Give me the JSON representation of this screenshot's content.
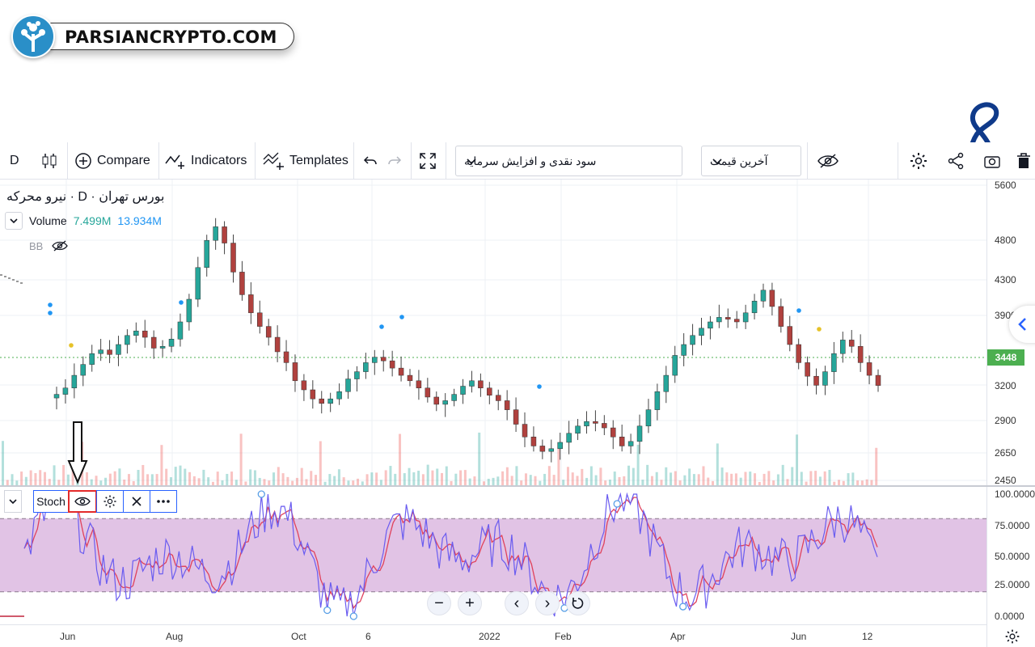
{
  "logo": {
    "text": "PARSIANCRYPTO.COM"
  },
  "toolbar": {
    "interval": "D",
    "compare_label": "Compare",
    "indicators_label": "Indicators",
    "templates_label": "Templates",
    "symbol_dropdown": "سود نقدی و افزایش سرمایه",
    "price_dropdown": "آخرین قیمت"
  },
  "legend": {
    "title": "بورس تهران · D · نیرو محرکه",
    "volume_label": "Volume",
    "volume_v1": "7.499M",
    "volume_v2": "13.934M",
    "bb_label": "BB",
    "stoch_label": "Stoch"
  },
  "price_axis": [
    "5600",
    "4800",
    "4300",
    "3900",
    "3448",
    "3200",
    "2900",
    "2650",
    "2450"
  ],
  "current_price": "3448",
  "stoch_axis": [
    "100.0000",
    "75.0000",
    "50.0000",
    "25.0000",
    "0.0000"
  ],
  "time_axis": [
    "Jun",
    "Aug",
    "Oct",
    "6",
    "2022",
    "Feb",
    "Apr",
    "Jun",
    "12"
  ],
  "colors": {
    "up": "#26a69a",
    "down": "#b0413e",
    "stoch_k": "#6a5cf0",
    "stoch_d": "#e0425c",
    "band": "#dcb9e0",
    "accent": "#2962ff"
  },
  "chart_data": {
    "type": "candlestick",
    "close": [
      3350,
      3420,
      3560,
      3680,
      3800,
      3840,
      3790,
      3900,
      4000,
      4050,
      3980,
      3860,
      3880,
      3960,
      4150,
      4400,
      4750,
      5050,
      5200,
      5020,
      4700,
      4450,
      4250,
      4100,
      3980,
      3820,
      3700,
      3500,
      3400,
      3300,
      3250,
      3300,
      3380,
      3520,
      3600,
      3700,
      3760,
      3720,
      3640,
      3560,
      3500,
      3420,
      3320,
      3240,
      3280,
      3350,
      3440,
      3500,
      3420,
      3340,
      3280,
      3180,
      3020,
      2880,
      2780,
      2720,
      2750,
      2820,
      2920,
      3000,
      3050,
      3030,
      2980,
      2880,
      2780,
      2830,
      3000,
      3180,
      3380,
      3560,
      3780,
      3900,
      4000,
      4080,
      4150,
      4200,
      4180,
      4150,
      4250,
      4380,
      4500,
      4320,
      4100,
      3900,
      3700,
      3550,
      3450,
      3600,
      3800,
      3950,
      3880,
      3700,
      3560,
      3448
    ],
    "ylim": [
      2400,
      5650
    ],
    "stochastic": {
      "ylim": [
        0,
        100
      ],
      "band": [
        20,
        80
      ]
    }
  }
}
